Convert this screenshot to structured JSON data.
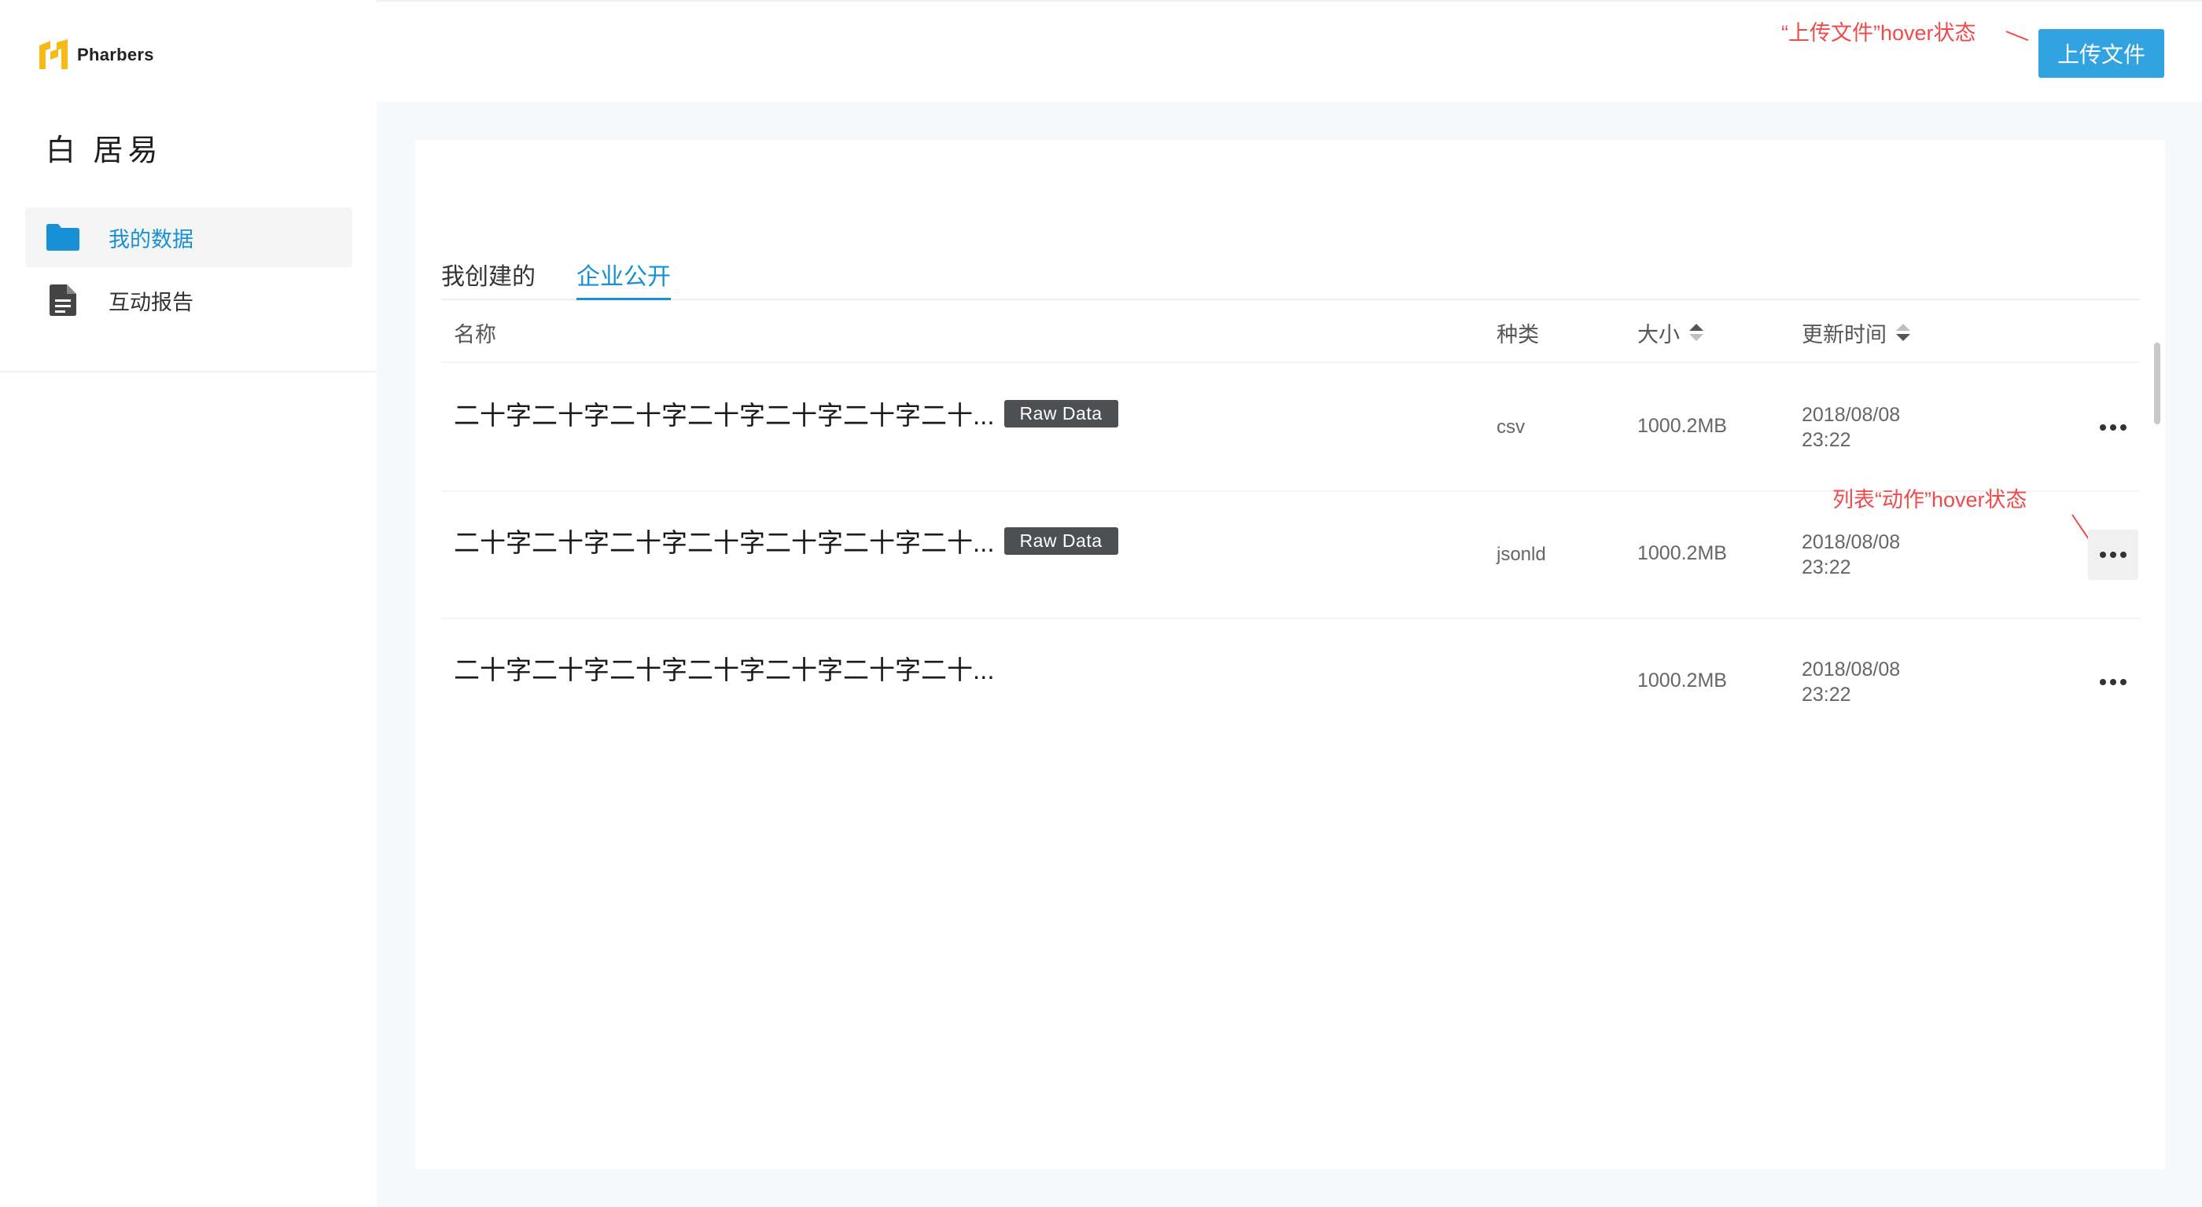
{
  "brand": {
    "name": "Pharbers",
    "logo_icon": "pharbers-logo-icon",
    "accent": "#1890d5"
  },
  "user": {
    "name": "白 居易"
  },
  "sidebar": {
    "items": [
      {
        "label": "我的数据",
        "icon": "folder-icon",
        "active": true
      },
      {
        "label": "互动报告",
        "icon": "document-icon",
        "active": false
      }
    ]
  },
  "header": {
    "upload_label": "上传文件",
    "upload_color": "#31a3e0"
  },
  "annotations": {
    "upload_hover": "“上传文件”hover状态",
    "action_hover": "列表“动作”hover状态",
    "color": "#f04a4a"
  },
  "tabs": [
    {
      "label": "我创建的",
      "active": false
    },
    {
      "label": "企业公开",
      "active": true
    }
  ],
  "table": {
    "columns": {
      "name": "名称",
      "type": "种类",
      "size": "大小",
      "time": "更新时间"
    },
    "rows": [
      {
        "name": "二十字二十字二十字二十字二十字二十字二十...",
        "badge": "Raw Data",
        "type": "csv",
        "size": "1000.2MB",
        "date": "2018/08/08",
        "time": "23:22",
        "action_icon": "more-icon"
      },
      {
        "name": "二十字二十字二十字二十字二十字二十字二十...",
        "badge": "Raw Data",
        "type": "jsonld",
        "size": "1000.2MB",
        "date": "2018/08/08",
        "time": "23:22",
        "action_icon": "more-icon"
      },
      {
        "name": "二十字二十字二十字二十字二十字二十字二十...",
        "badge": "",
        "type": "",
        "size": "1000.2MB",
        "date": "2018/08/08",
        "time": "23:22",
        "action_icon": "more-icon"
      }
    ]
  }
}
